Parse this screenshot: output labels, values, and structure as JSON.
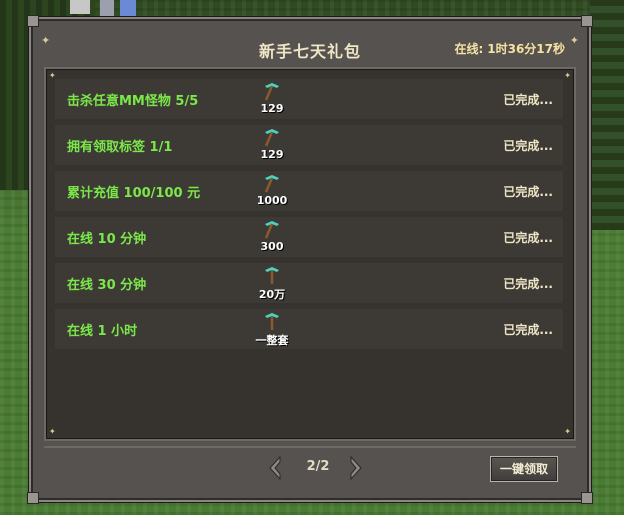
{
  "panel": {
    "title": "新手七天礼包",
    "online_label": "在线:",
    "online_time": "1时36分17秒"
  },
  "rows": [
    {
      "label": "击杀任意MM怪物 5/5",
      "reward": "129",
      "status": "已完成..."
    },
    {
      "label": "拥有领取标签 1/1",
      "reward": "129",
      "status": "已完成..."
    },
    {
      "label": "累计充值 100/100 元",
      "reward": "1000",
      "status": "已完成..."
    },
    {
      "label": "在线 10 分钟",
      "reward": "300",
      "status": "已完成..."
    },
    {
      "label": "在线 30 分钟",
      "reward": "20万",
      "status": "已完成..."
    },
    {
      "label": "在线 1 小时",
      "reward": "一整套",
      "status": "已完成..."
    }
  ],
  "pager": {
    "current": "2/2"
  },
  "claim_all_label": "一键领取",
  "colors": {
    "task_text": "#7be84a",
    "status_text": "#efe6c6",
    "panel_bg": "#555250",
    "list_bg": "#36332f"
  },
  "icons": {
    "reward": "diamond-pickaxe-icon",
    "prev": "left-arrow-icon",
    "next": "right-arrow-icon"
  }
}
